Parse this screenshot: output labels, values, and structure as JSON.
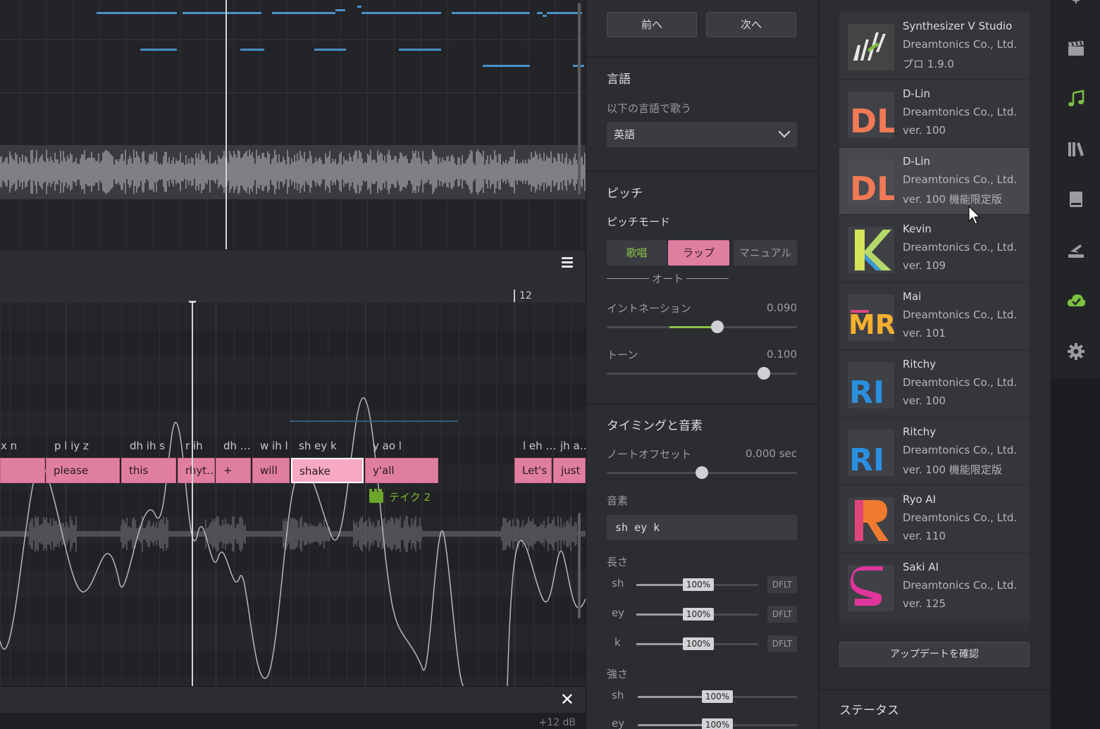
{
  "nav": {
    "prev_label": "前へ",
    "next_label": "次へ"
  },
  "language": {
    "section_title": "言語",
    "sing_label": "以下の言語で歌う",
    "selected": "英語"
  },
  "pitch": {
    "section_title": "ピッチ",
    "mode_label": "ピッチモード",
    "modes": [
      "歌唱",
      "ラップ",
      "マニュアル"
    ],
    "active_mode": "ラップ",
    "auto_label": "オート",
    "intonation_label": "イントネーション",
    "intonation_value": "0.090",
    "intonation_level": 0.58,
    "tone_label": "トーン",
    "tone_value": "0.100",
    "tone_level": 0.82
  },
  "timing": {
    "section_title": "タイミングと音素",
    "offset_label": "ノートオフセット",
    "offset_value": "0.000 sec",
    "offset_level": 0.5,
    "phoneme_label": "音素",
    "phoneme_value": "sh ey k",
    "duration_label": "長さ",
    "durations": [
      {
        "ph": "sh",
        "pct": "100%",
        "dflt": "DFLT"
      },
      {
        "ph": "ey",
        "pct": "100%",
        "dflt": "DFLT"
      },
      {
        "ph": "k",
        "pct": "100%",
        "dflt": "DFLT"
      }
    ],
    "strength_label": "強さ",
    "strengths": [
      {
        "ph": "sh",
        "pct": "100%"
      },
      {
        "ph": "ey",
        "pct": "100%"
      }
    ]
  },
  "editor": {
    "bar_marker": "12",
    "phonemes": [
      "x n",
      "p l iy z",
      "dh ih s",
      "r ih",
      "dh …",
      "w ih l",
      "sh ey k",
      "y ao l",
      "l eh …",
      "jh a…"
    ],
    "notes": [
      "please",
      "this",
      "rhyt…",
      "+",
      "will",
      "shake",
      "y'all",
      "Let's",
      "just"
    ],
    "take_label": "テイク 2",
    "db_label": "+12 dB"
  },
  "voices": {
    "items": [
      {
        "name": "Synthesizer V Studio",
        "company": "Dreamtonics Co., Ltd.",
        "version": "プロ 1.9.0",
        "icon": "sv-logo"
      },
      {
        "name": "D-Lin",
        "company": "Dreamtonics Co., Ltd.",
        "version": "ver. 100",
        "icon": "dl-logo"
      },
      {
        "name": "D-Lin",
        "company": "Dreamtonics Co., Ltd.",
        "version": "ver. 100 機能限定版",
        "icon": "dl-logo"
      },
      {
        "name": "Kevin",
        "company": "Dreamtonics Co., Ltd.",
        "version": "ver. 109",
        "icon": "k-logo"
      },
      {
        "name": "Mai",
        "company": "Dreamtonics Co., Ltd.",
        "version": "ver. 101",
        "icon": "mr-logo"
      },
      {
        "name": "Ritchy",
        "company": "Dreamtonics Co., Ltd.",
        "version": "ver. 100",
        "icon": "ri-logo"
      },
      {
        "name": "Ritchy",
        "company": "Dreamtonics Co., Ltd.",
        "version": "ver. 100 機能限定版",
        "icon": "ri-logo"
      },
      {
        "name": "Ryo AI",
        "company": "Dreamtonics Co., Ltd.",
        "version": "ver. 110",
        "icon": "r-logo"
      },
      {
        "name": "Saki AI",
        "company": "Dreamtonics Co., Ltd.",
        "version": "ver. 125",
        "icon": "s-logo"
      }
    ],
    "update_label": "アップデートを確認",
    "status_title": "ステータス"
  },
  "rail": {
    "icons": [
      "microphone-icon",
      "clapperboard-icon",
      "music-note-icon",
      "library-icon",
      "book-icon",
      "render-icon",
      "cloud-check-icon",
      "gear-icon"
    ],
    "active": "music-note-icon",
    "accent": "#7cc142"
  },
  "colors": {
    "note": "#e07ea0",
    "note_selected": "#f7a8c4",
    "arrangement_note": "#4a90c8",
    "accent_green": "#7cc142",
    "active_segment": "#e07ea0"
  }
}
